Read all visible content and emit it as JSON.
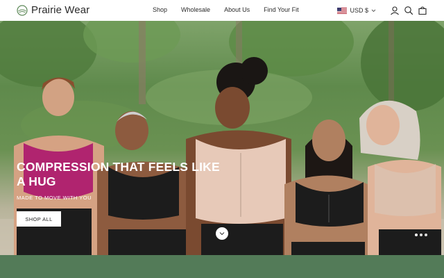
{
  "brand": {
    "name": "Prairie Wear"
  },
  "nav": {
    "items": [
      "Shop",
      "Wholesale",
      "About Us",
      "Find Your Fit"
    ]
  },
  "currency": {
    "label": "USD $"
  },
  "icons": {
    "account": "account-icon",
    "search": "search-icon",
    "cart": "cart-icon",
    "chevron": "chevron-down-icon",
    "flag": "us-flag-icon",
    "scroll": "chevron-down-icon"
  },
  "hero": {
    "headline": "COMPRESSION THAT FEELS LIKE A HUG",
    "subheadline": "MADE TO MOVE WITH YOU",
    "cta_label": "SHOP ALL",
    "slides_count": 3,
    "active_slide": 1
  },
  "colors": {
    "band": "#537b58",
    "magenta_top": "#b0246f",
    "nude_top": "#e7c9b8",
    "black_top": "#1c1c1c"
  }
}
